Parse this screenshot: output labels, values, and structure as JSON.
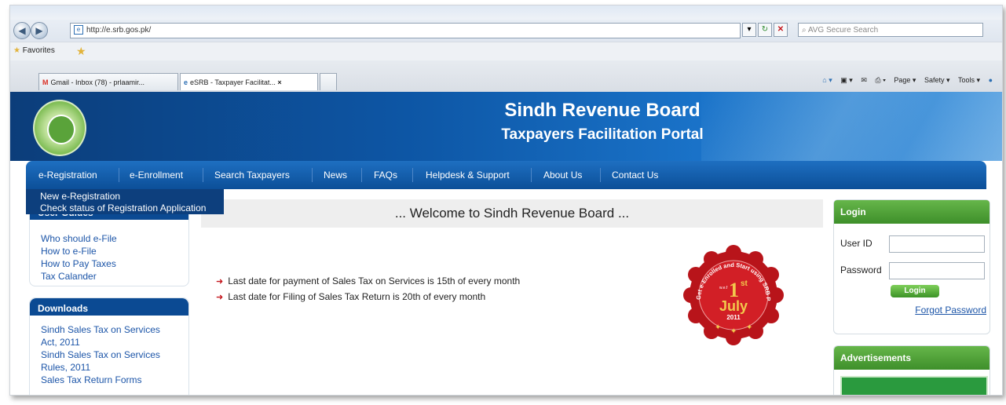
{
  "browser": {
    "address": "http://e.srb.gos.pk/",
    "search_placeholder": "AVG Secure Search",
    "favorites_label": "Favorites",
    "tabs": [
      {
        "label": "Gmail - Inbox (78) - prlaamir...",
        "icon": "gmail-icon"
      },
      {
        "label": "eSRB - Taxpayer Facilitat...",
        "icon": "ie-page-icon"
      }
    ],
    "tab_close": "×",
    "tools": [
      "Page ▾",
      "Safety ▾",
      "Tools ▾"
    ]
  },
  "header": {
    "title": "Sindh Revenue Board",
    "subtitle": "Taxpayers Facilitation Portal"
  },
  "menu": {
    "items": [
      "e-Registration",
      "e-Enrollment",
      "Search Taxpayers",
      "News",
      "FAQs",
      "Helpdesk & Support",
      "About Us",
      "Contact Us"
    ],
    "dropdown": [
      "New e-Registration",
      "Check status of Registration Application"
    ]
  },
  "sidebar": {
    "user_guides": {
      "heading": "User Guides",
      "links": [
        "Who should e-File",
        "How to e-File",
        "How to Pay Taxes",
        "Tax Calander"
      ]
    },
    "downloads": {
      "heading": "Downloads",
      "links": [
        "Sindh Sales Tax on Services Act, 2011",
        "Sindh Sales Tax on Services Rules, 2011",
        "Sales Tax Return Forms"
      ]
    }
  },
  "main": {
    "welcome": "... Welcome to Sindh Revenue Board ...",
    "news": [
      "Last date for payment of Sales Tax on Services is 15th of every month",
      "Last date for Filing of Sales Tax Return is 20th of every month"
    ],
    "badge": {
      "arc_text": "Get e-Enrolled and Start using SRB Portal",
      "wef": "w.e.f",
      "day": "1",
      "ordinal": "st",
      "month": "July",
      "year": "2011"
    }
  },
  "login": {
    "heading": "Login",
    "user_id_label": "User ID",
    "password_label": "Password",
    "button": "Login",
    "forgot": "Forgot Password"
  },
  "ads": {
    "heading": "Advertisements"
  },
  "colors": {
    "banner": "#0d56a5",
    "menu": "#0c4f98",
    "green": "#3e8f2a",
    "badge_red": "#c4161c"
  }
}
